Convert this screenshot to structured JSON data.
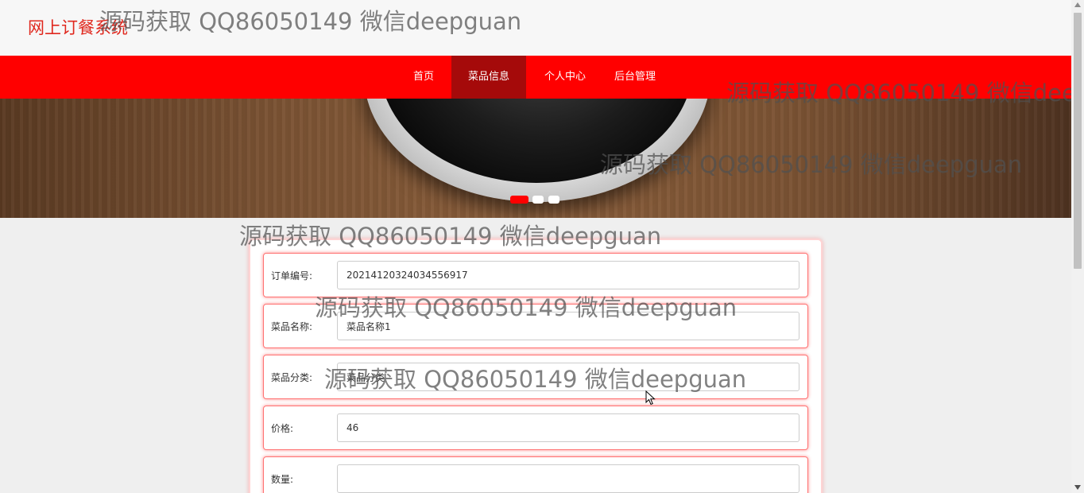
{
  "header": {
    "site_title": "网上订餐系统"
  },
  "nav": {
    "items": [
      {
        "label": "首页",
        "active": false
      },
      {
        "label": "菜品信息",
        "active": true
      },
      {
        "label": "个人中心",
        "active": false
      },
      {
        "label": "后台管理",
        "active": false
      }
    ]
  },
  "carousel": {
    "slide_count": 3,
    "active_index": 0,
    "active_color": "#ff0000"
  },
  "form": {
    "fields": [
      {
        "label": "订单编号:",
        "value": "20214120324034556917"
      },
      {
        "label": "菜品名称:",
        "value": "菜品名称1"
      },
      {
        "label": "菜品分类:",
        "value": "菜品分类"
      },
      {
        "label": "价格:",
        "value": "46"
      },
      {
        "label": "数量:",
        "value": ""
      }
    ]
  },
  "watermark": {
    "text": "源码获取 QQ86050149 微信deepguan"
  },
  "colors": {
    "brand_red": "#ff0000",
    "nav_active": "#a50a0a",
    "title_red": "#e0281e"
  }
}
